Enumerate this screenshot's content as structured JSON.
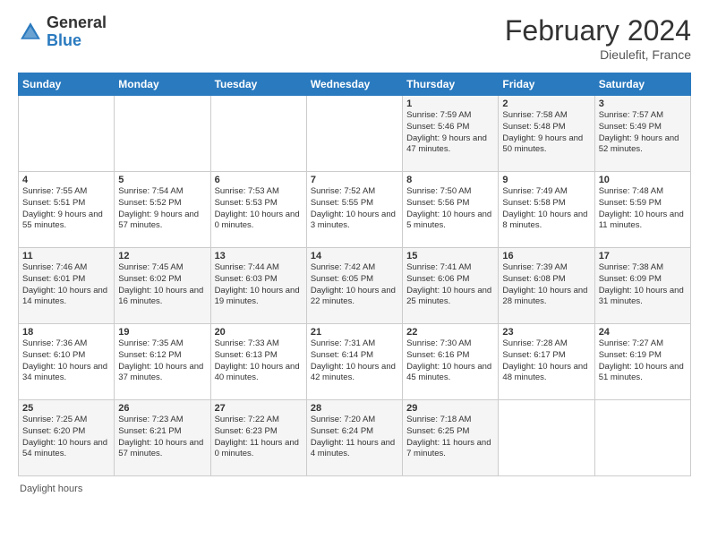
{
  "header": {
    "logo_general": "General",
    "logo_blue": "Blue",
    "title": "February 2024",
    "location": "Dieulefit, France"
  },
  "weekdays": [
    "Sunday",
    "Monday",
    "Tuesday",
    "Wednesday",
    "Thursday",
    "Friday",
    "Saturday"
  ],
  "weeks": [
    [
      {
        "day": "",
        "info": ""
      },
      {
        "day": "",
        "info": ""
      },
      {
        "day": "",
        "info": ""
      },
      {
        "day": "",
        "info": ""
      },
      {
        "day": "1",
        "info": "Sunrise: 7:59 AM\nSunset: 5:46 PM\nDaylight: 9 hours\nand 47 minutes."
      },
      {
        "day": "2",
        "info": "Sunrise: 7:58 AM\nSunset: 5:48 PM\nDaylight: 9 hours\nand 50 minutes."
      },
      {
        "day": "3",
        "info": "Sunrise: 7:57 AM\nSunset: 5:49 PM\nDaylight: 9 hours\nand 52 minutes."
      }
    ],
    [
      {
        "day": "4",
        "info": "Sunrise: 7:55 AM\nSunset: 5:51 PM\nDaylight: 9 hours\nand 55 minutes."
      },
      {
        "day": "5",
        "info": "Sunrise: 7:54 AM\nSunset: 5:52 PM\nDaylight: 9 hours\nand 57 minutes."
      },
      {
        "day": "6",
        "info": "Sunrise: 7:53 AM\nSunset: 5:53 PM\nDaylight: 10 hours\nand 0 minutes."
      },
      {
        "day": "7",
        "info": "Sunrise: 7:52 AM\nSunset: 5:55 PM\nDaylight: 10 hours\nand 3 minutes."
      },
      {
        "day": "8",
        "info": "Sunrise: 7:50 AM\nSunset: 5:56 PM\nDaylight: 10 hours\nand 5 minutes."
      },
      {
        "day": "9",
        "info": "Sunrise: 7:49 AM\nSunset: 5:58 PM\nDaylight: 10 hours\nand 8 minutes."
      },
      {
        "day": "10",
        "info": "Sunrise: 7:48 AM\nSunset: 5:59 PM\nDaylight: 10 hours\nand 11 minutes."
      }
    ],
    [
      {
        "day": "11",
        "info": "Sunrise: 7:46 AM\nSunset: 6:01 PM\nDaylight: 10 hours\nand 14 minutes."
      },
      {
        "day": "12",
        "info": "Sunrise: 7:45 AM\nSunset: 6:02 PM\nDaylight: 10 hours\nand 16 minutes."
      },
      {
        "day": "13",
        "info": "Sunrise: 7:44 AM\nSunset: 6:03 PM\nDaylight: 10 hours\nand 19 minutes."
      },
      {
        "day": "14",
        "info": "Sunrise: 7:42 AM\nSunset: 6:05 PM\nDaylight: 10 hours\nand 22 minutes."
      },
      {
        "day": "15",
        "info": "Sunrise: 7:41 AM\nSunset: 6:06 PM\nDaylight: 10 hours\nand 25 minutes."
      },
      {
        "day": "16",
        "info": "Sunrise: 7:39 AM\nSunset: 6:08 PM\nDaylight: 10 hours\nand 28 minutes."
      },
      {
        "day": "17",
        "info": "Sunrise: 7:38 AM\nSunset: 6:09 PM\nDaylight: 10 hours\nand 31 minutes."
      }
    ],
    [
      {
        "day": "18",
        "info": "Sunrise: 7:36 AM\nSunset: 6:10 PM\nDaylight: 10 hours\nand 34 minutes."
      },
      {
        "day": "19",
        "info": "Sunrise: 7:35 AM\nSunset: 6:12 PM\nDaylight: 10 hours\nand 37 minutes."
      },
      {
        "day": "20",
        "info": "Sunrise: 7:33 AM\nSunset: 6:13 PM\nDaylight: 10 hours\nand 40 minutes."
      },
      {
        "day": "21",
        "info": "Sunrise: 7:31 AM\nSunset: 6:14 PM\nDaylight: 10 hours\nand 42 minutes."
      },
      {
        "day": "22",
        "info": "Sunrise: 7:30 AM\nSunset: 6:16 PM\nDaylight: 10 hours\nand 45 minutes."
      },
      {
        "day": "23",
        "info": "Sunrise: 7:28 AM\nSunset: 6:17 PM\nDaylight: 10 hours\nand 48 minutes."
      },
      {
        "day": "24",
        "info": "Sunrise: 7:27 AM\nSunset: 6:19 PM\nDaylight: 10 hours\nand 51 minutes."
      }
    ],
    [
      {
        "day": "25",
        "info": "Sunrise: 7:25 AM\nSunset: 6:20 PM\nDaylight: 10 hours\nand 54 minutes."
      },
      {
        "day": "26",
        "info": "Sunrise: 7:23 AM\nSunset: 6:21 PM\nDaylight: 10 hours\nand 57 minutes."
      },
      {
        "day": "27",
        "info": "Sunrise: 7:22 AM\nSunset: 6:23 PM\nDaylight: 11 hours\nand 0 minutes."
      },
      {
        "day": "28",
        "info": "Sunrise: 7:20 AM\nSunset: 6:24 PM\nDaylight: 11 hours\nand 4 minutes."
      },
      {
        "day": "29",
        "info": "Sunrise: 7:18 AM\nSunset: 6:25 PM\nDaylight: 11 hours\nand 7 minutes."
      },
      {
        "day": "",
        "info": ""
      },
      {
        "day": "",
        "info": ""
      }
    ]
  ],
  "footer": "Daylight hours"
}
